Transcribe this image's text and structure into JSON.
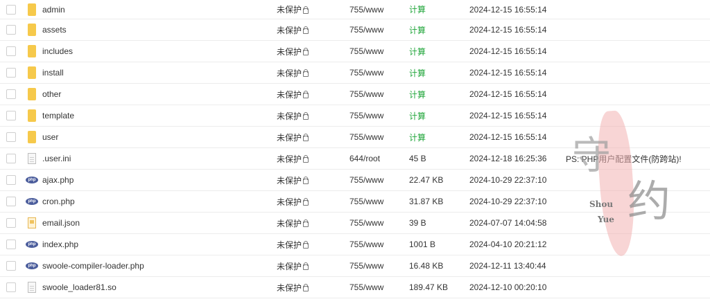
{
  "files": [
    {
      "name": "admin",
      "type": "folder",
      "protect": "未保护",
      "perm": "755/www",
      "size": "计算",
      "size_calc": true,
      "time": "2024-12-15 16:55:14",
      "note": ""
    },
    {
      "name": "assets",
      "type": "folder",
      "protect": "未保护",
      "perm": "755/www",
      "size": "计算",
      "size_calc": true,
      "time": "2024-12-15 16:55:14",
      "note": ""
    },
    {
      "name": "includes",
      "type": "folder",
      "protect": "未保护",
      "perm": "755/www",
      "size": "计算",
      "size_calc": true,
      "time": "2024-12-15 16:55:14",
      "note": ""
    },
    {
      "name": "install",
      "type": "folder",
      "protect": "未保护",
      "perm": "755/www",
      "size": "计算",
      "size_calc": true,
      "time": "2024-12-15 16:55:14",
      "note": ""
    },
    {
      "name": "other",
      "type": "folder",
      "protect": "未保护",
      "perm": "755/www",
      "size": "计算",
      "size_calc": true,
      "time": "2024-12-15 16:55:14",
      "note": ""
    },
    {
      "name": "template",
      "type": "folder",
      "protect": "未保护",
      "perm": "755/www",
      "size": "计算",
      "size_calc": true,
      "time": "2024-12-15 16:55:14",
      "note": ""
    },
    {
      "name": "user",
      "type": "folder",
      "protect": "未保护",
      "perm": "755/www",
      "size": "计算",
      "size_calc": true,
      "time": "2024-12-15 16:55:14",
      "note": ""
    },
    {
      "name": ".user.ini",
      "type": "file",
      "protect": "未保护",
      "perm": "644/root",
      "size": "45 B",
      "size_calc": false,
      "time": "2024-12-18 16:25:36",
      "note": "PS: PHP用户配置文件(防跨站)!"
    },
    {
      "name": "ajax.php",
      "type": "php",
      "protect": "未保护",
      "perm": "755/www",
      "size": "22.47 KB",
      "size_calc": false,
      "time": "2024-10-29 22:37:10",
      "note": ""
    },
    {
      "name": "cron.php",
      "type": "php",
      "protect": "未保护",
      "perm": "755/www",
      "size": "31.87 KB",
      "size_calc": false,
      "time": "2024-10-29 22:37:10",
      "note": ""
    },
    {
      "name": "email.json",
      "type": "json",
      "protect": "未保护",
      "perm": "755/www",
      "size": "39 B",
      "size_calc": false,
      "time": "2024-07-07 14:04:58",
      "note": ""
    },
    {
      "name": "index.php",
      "type": "php",
      "protect": "未保护",
      "perm": "755/www",
      "size": "1001 B",
      "size_calc": false,
      "time": "2024-04-10 20:21:12",
      "note": ""
    },
    {
      "name": "swoole-compiler-loader.php",
      "type": "php",
      "protect": "未保护",
      "perm": "755/www",
      "size": "16.48 KB",
      "size_calc": false,
      "time": "2024-12-11 13:40:44",
      "note": ""
    },
    {
      "name": "swoole_loader81.so",
      "type": "file",
      "protect": "未保护",
      "perm": "755/www",
      "size": "189.47 KB",
      "size_calc": false,
      "time": "2024-12-10 00:20:10",
      "note": ""
    }
  ],
  "watermark": {
    "char1": "守",
    "char2": "约",
    "text1": "Shou",
    "text2": "Yue"
  },
  "php_icon_text": "php",
  "colors": {
    "calc": "#20a53a",
    "folder": "#f6c94b",
    "php": "#4b5d9c"
  }
}
